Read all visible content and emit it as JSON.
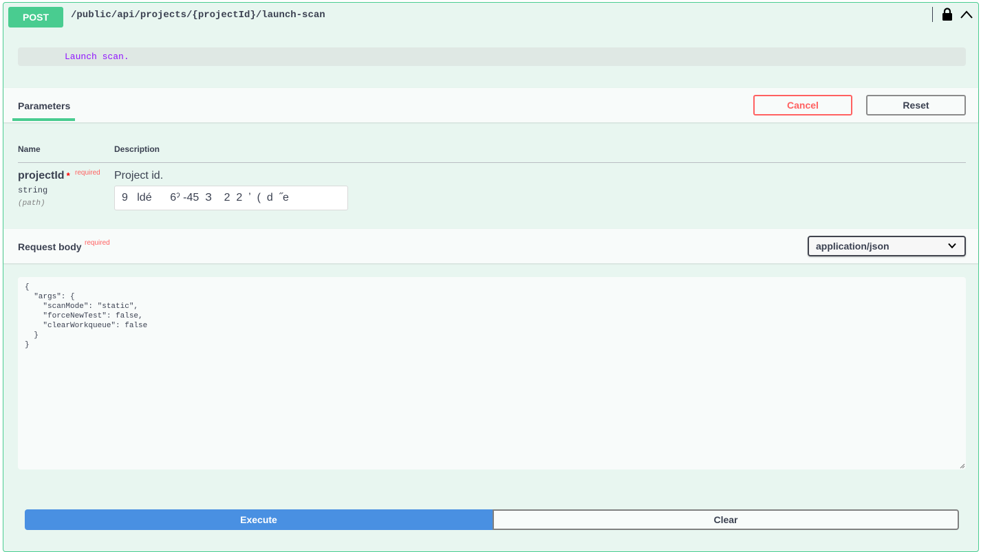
{
  "operation": {
    "method": "POST",
    "path": "/public/api/projects/{projectId}/launch-scan",
    "summary": "Launch scan."
  },
  "icons": {
    "lock": "lock-icon",
    "collapse": "chevron-up-icon",
    "dropdown": "chevron-down-icon"
  },
  "parameters_section": {
    "tab_label": "Parameters",
    "cancel_label": "Cancel",
    "reset_label": "Reset",
    "col_name": "Name",
    "col_description": "Description"
  },
  "parameter": {
    "name": "projectId",
    "star": "*",
    "required_label": "required",
    "type": "string",
    "location": "(path)",
    "description": "Project id.",
    "value": "9   ldé      6ˀ -45  З    2  2  ʼ  (  d  ˝e"
  },
  "request_body": {
    "title": "Request body",
    "required_label": "required",
    "content_type": "application/json",
    "content": "{\n  \"args\": {\n    \"scanMode\": \"static\",\n    \"forceNewTest\": false,\n    \"clearWorkqueue\": false\n  }\n}"
  },
  "actions": {
    "execute_label": "Execute",
    "clear_label": "Clear"
  },
  "colors": {
    "post_accent": "#49cc90",
    "execute_blue": "#4990e2",
    "cancel_red": "#ff6060"
  }
}
